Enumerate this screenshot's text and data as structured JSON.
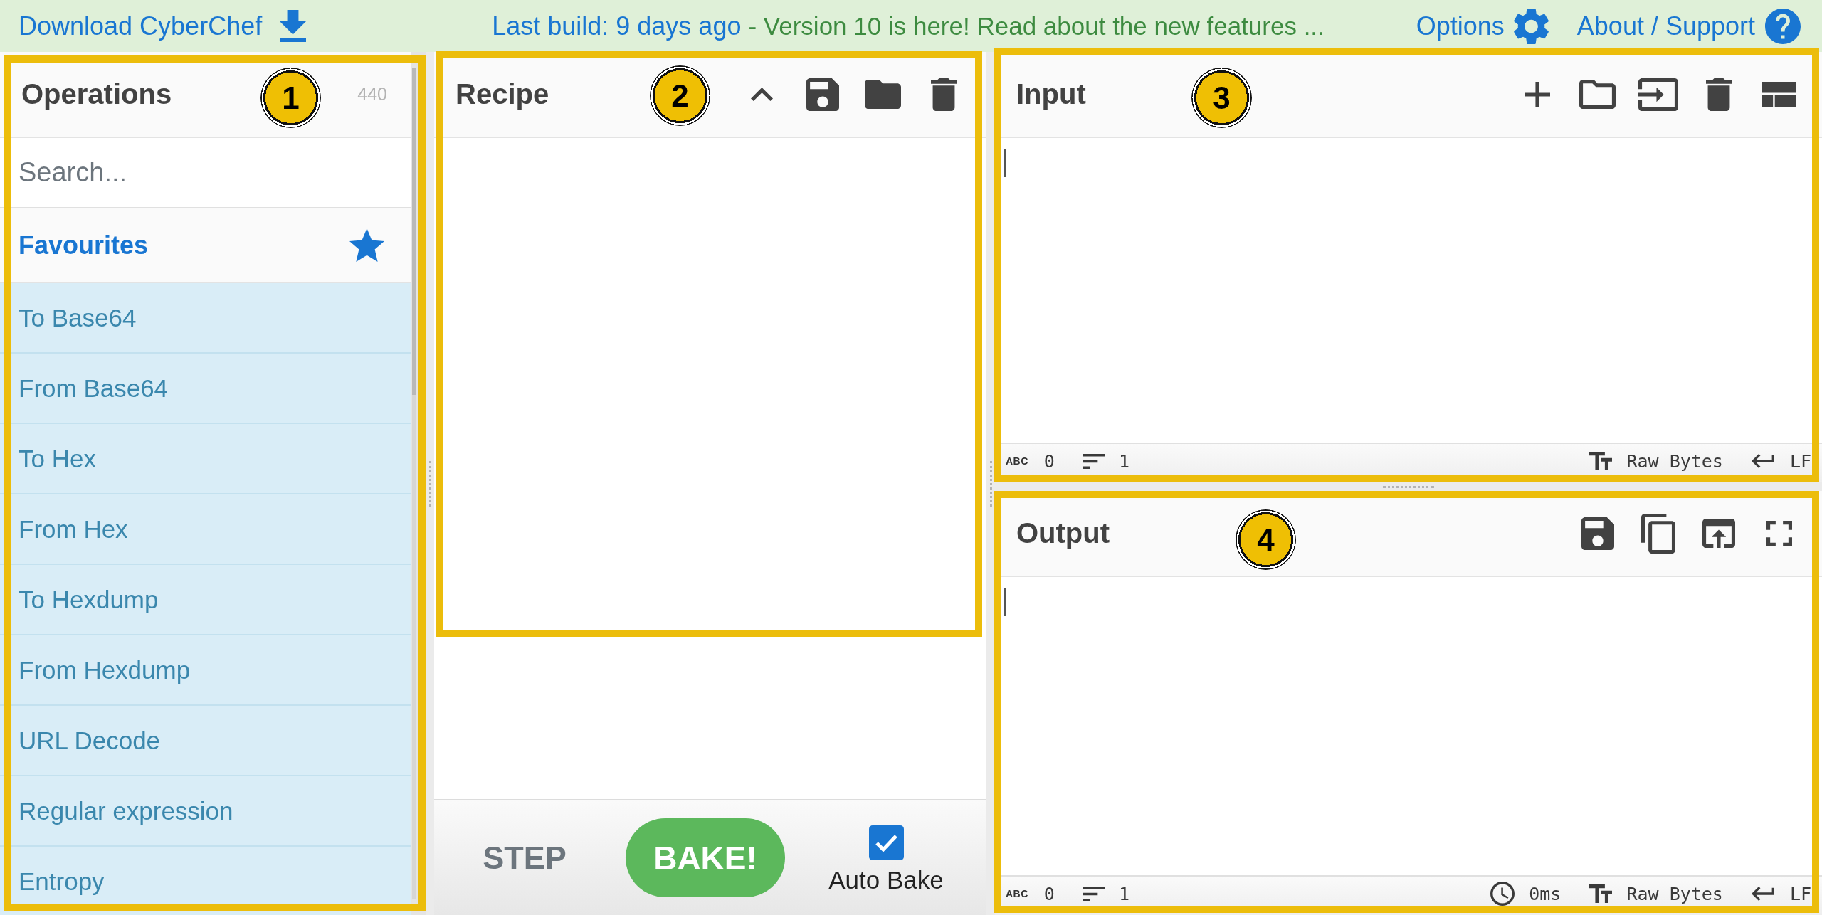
{
  "top_bar": {
    "download": "Download CyberChef",
    "build": "Last build: 9 days ago",
    "notice": "- Version 10 is here! Read about the new features ...",
    "options": "Options",
    "about": "About / Support"
  },
  "operations": {
    "title": "Operations",
    "count": "440",
    "callout": "1",
    "search": {
      "placeholder": "Search..."
    },
    "category": "Favourites",
    "items": [
      "To Base64",
      "From Base64",
      "To Hex",
      "From Hex",
      "To Hexdump",
      "From Hexdump",
      "URL Decode",
      "Regular expression",
      "Entropy"
    ]
  },
  "recipe": {
    "title": "Recipe",
    "callout": "2"
  },
  "bake_controls": {
    "step": "STEP",
    "bake": "BAKE!",
    "auto_bake": {
      "label": "Auto Bake",
      "checked": true
    }
  },
  "input": {
    "title": "Input",
    "callout": "3",
    "status": {
      "chars_icon": "ABC",
      "chars": "0",
      "lines": "1",
      "encoding": "Raw Bytes",
      "eol": "LF"
    }
  },
  "output": {
    "title": "Output",
    "callout": "4",
    "status": {
      "chars_icon": "ABC",
      "chars": "0",
      "lines": "1",
      "time": "0ms",
      "encoding": "Raw Bytes",
      "eol": "LF"
    }
  }
}
